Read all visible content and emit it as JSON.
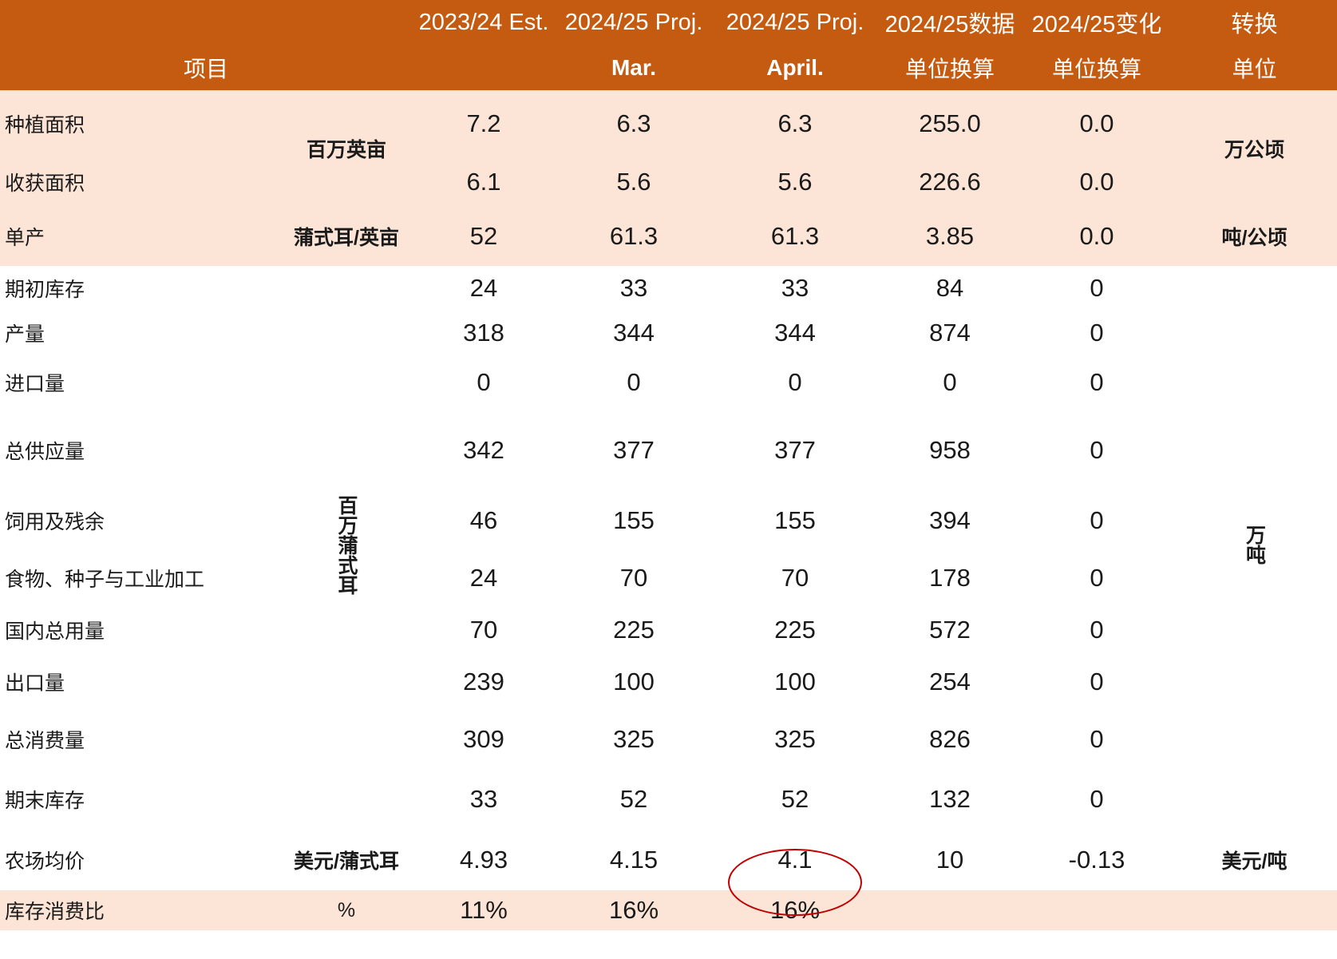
{
  "header": {
    "row1": [
      "2023/24 Est.",
      "2024/25 Proj.",
      "2024/25 Proj.",
      "2024/25数据",
      "2024/25变化",
      "转换"
    ],
    "row2": [
      "项目",
      "Mar.",
      "April.",
      "单位换算",
      "单位换算",
      "单位"
    ]
  },
  "units": {
    "area_us": "百万英亩",
    "yield_us": "蒲式耳/英亩",
    "volume_us": "百万蒲式耳",
    "price_us": "美元/蒲式耳",
    "ratio": "%",
    "area_cn": "万公顷",
    "yield_cn": "吨/公顷",
    "volume_cn": "万吨",
    "price_cn": "美元/吨"
  },
  "rows": [
    {
      "label": "种植面积",
      "values": [
        "7.2",
        "6.3",
        "6.3",
        "255.0",
        "0.0"
      ]
    },
    {
      "label": "收获面积",
      "values": [
        "6.1",
        "5.6",
        "5.6",
        "226.6",
        "0.0"
      ]
    },
    {
      "label": "单产",
      "values": [
        "52",
        "61.3",
        "61.3",
        "3.85",
        "0.0"
      ]
    },
    {
      "label": "期初库存",
      "values": [
        "24",
        "33",
        "33",
        "84",
        "0"
      ]
    },
    {
      "label": "产量",
      "values": [
        "318",
        "344",
        "344",
        "874",
        "0"
      ]
    },
    {
      "label": "进口量",
      "values": [
        "0",
        "0",
        "0",
        "0",
        "0"
      ]
    },
    {
      "label": "总供应量",
      "values": [
        "342",
        "377",
        "377",
        "958",
        "0"
      ]
    },
    {
      "label": "饲用及残余",
      "values": [
        "46",
        "155",
        "155",
        "394",
        "0"
      ]
    },
    {
      "label": "食物、种子与工业加工",
      "values": [
        "24",
        "70",
        "70",
        "178",
        "0"
      ]
    },
    {
      "label": "国内总用量",
      "values": [
        "70",
        "225",
        "225",
        "572",
        "0"
      ]
    },
    {
      "label": "出口量",
      "values": [
        "239",
        "100",
        "100",
        "254",
        "0"
      ]
    },
    {
      "label": "总消费量",
      "values": [
        "309",
        "325",
        "325",
        "826",
        "0"
      ]
    },
    {
      "label": "期末库存",
      "values": [
        "33",
        "52",
        "52",
        "132",
        "0"
      ]
    },
    {
      "label": "农场均价",
      "values": [
        "4.93",
        "4.15",
        "4.1",
        "10",
        "-0.13"
      ]
    },
    {
      "label": "库存消费比",
      "values": [
        "11%",
        "16%",
        "16%",
        "",
        ""
      ]
    }
  ],
  "colors": {
    "header_bg": "#c55a11",
    "shade_bg": "#fce4d6",
    "highlight_circle": "#c00000"
  }
}
